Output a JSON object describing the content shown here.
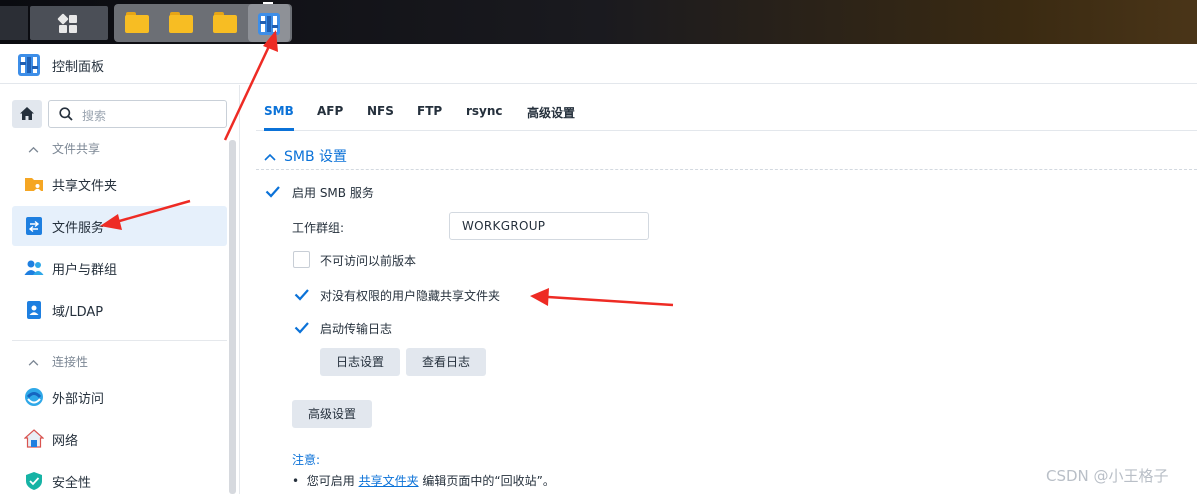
{
  "taskbar": {
    "icons": [
      "main-menu-icon",
      "folder-icon",
      "folder-icon",
      "folder-icon",
      "control-panel-icon"
    ]
  },
  "window": {
    "title": "控制面板"
  },
  "sidebar": {
    "search_placeholder": "搜索",
    "sections": [
      {
        "header": "文件共享",
        "items": [
          {
            "label": "共享文件夹",
            "icon": "shared-folder-icon"
          },
          {
            "label": "文件服务",
            "icon": "file-services-icon",
            "active": true
          },
          {
            "label": "用户与群组",
            "icon": "users-icon"
          },
          {
            "label": "域/LDAP",
            "icon": "domain-icon"
          }
        ]
      },
      {
        "header": "连接性",
        "items": [
          {
            "label": "外部访问",
            "icon": "external-access-icon"
          },
          {
            "label": "网络",
            "icon": "network-icon"
          },
          {
            "label": "安全性",
            "icon": "security-icon"
          }
        ]
      }
    ]
  },
  "tabs": [
    "SMB",
    "AFP",
    "NFS",
    "FTP",
    "rsync",
    "高级设置"
  ],
  "active_tab": "SMB",
  "smb": {
    "section_title": "SMB 设置",
    "enable_label": "启用 SMB 服务",
    "enable_checked": true,
    "workgroup_label": "工作群组:",
    "workgroup_value": "WORKGROUP",
    "options": [
      {
        "label": "不可访问以前版本",
        "checked": false
      },
      {
        "label": "对没有权限的用户隐藏共享文件夹",
        "checked": true
      },
      {
        "label": "启动传输日志",
        "checked": true
      }
    ],
    "log_settings_button": "日志设置",
    "view_log_button": "查看日志",
    "advanced_button": "高级设置",
    "note_title": "注意:",
    "note_prefix": "您可启用",
    "note_link": "共享文件夹",
    "note_suffix": "编辑页面中的“回收站”。"
  },
  "watermark": "CSDN @小王格子",
  "colors": {
    "accent": "#0b72d8",
    "annotation_arrow": "#ee2b24",
    "active_item_bg": "#e6f0fb",
    "folder": "#f7bd23"
  }
}
